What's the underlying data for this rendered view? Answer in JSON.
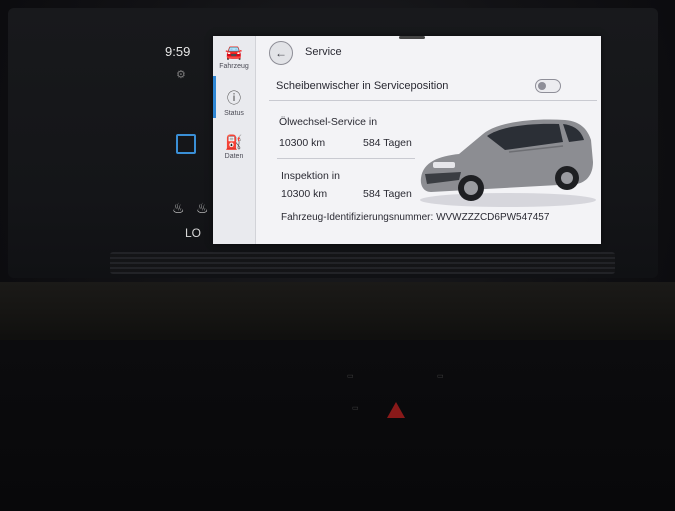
{
  "status_bar": {
    "time": "9:59",
    "climate_level": "LO"
  },
  "side_nav": {
    "items": [
      {
        "label": "Fahrzeug",
        "icon": "car-icon"
      },
      {
        "label": "Status",
        "icon": "info-icon"
      },
      {
        "label": "Daten",
        "icon": "fuel-data-icon"
      }
    ],
    "active": "Status"
  },
  "header": {
    "title": "Service"
  },
  "wiper": {
    "label": "Scheibenwischer in Serviceposition",
    "toggle_on": false
  },
  "oil_service": {
    "label": "Ölwechsel-Service in",
    "distance": "10300 km",
    "days": "584 Tagen"
  },
  "inspection": {
    "label": "Inspektion in",
    "distance": "10300 km",
    "days": "584 Tagen"
  },
  "vin": {
    "text": "Fahrzeug-Identifizierungsnummer: WVWZZZCD6PW547457"
  },
  "colors": {
    "screen_bg": "#f3f3f6",
    "accent": "#2f87d4",
    "text": "#2a2a33",
    "hazard": "#a01c1c"
  }
}
